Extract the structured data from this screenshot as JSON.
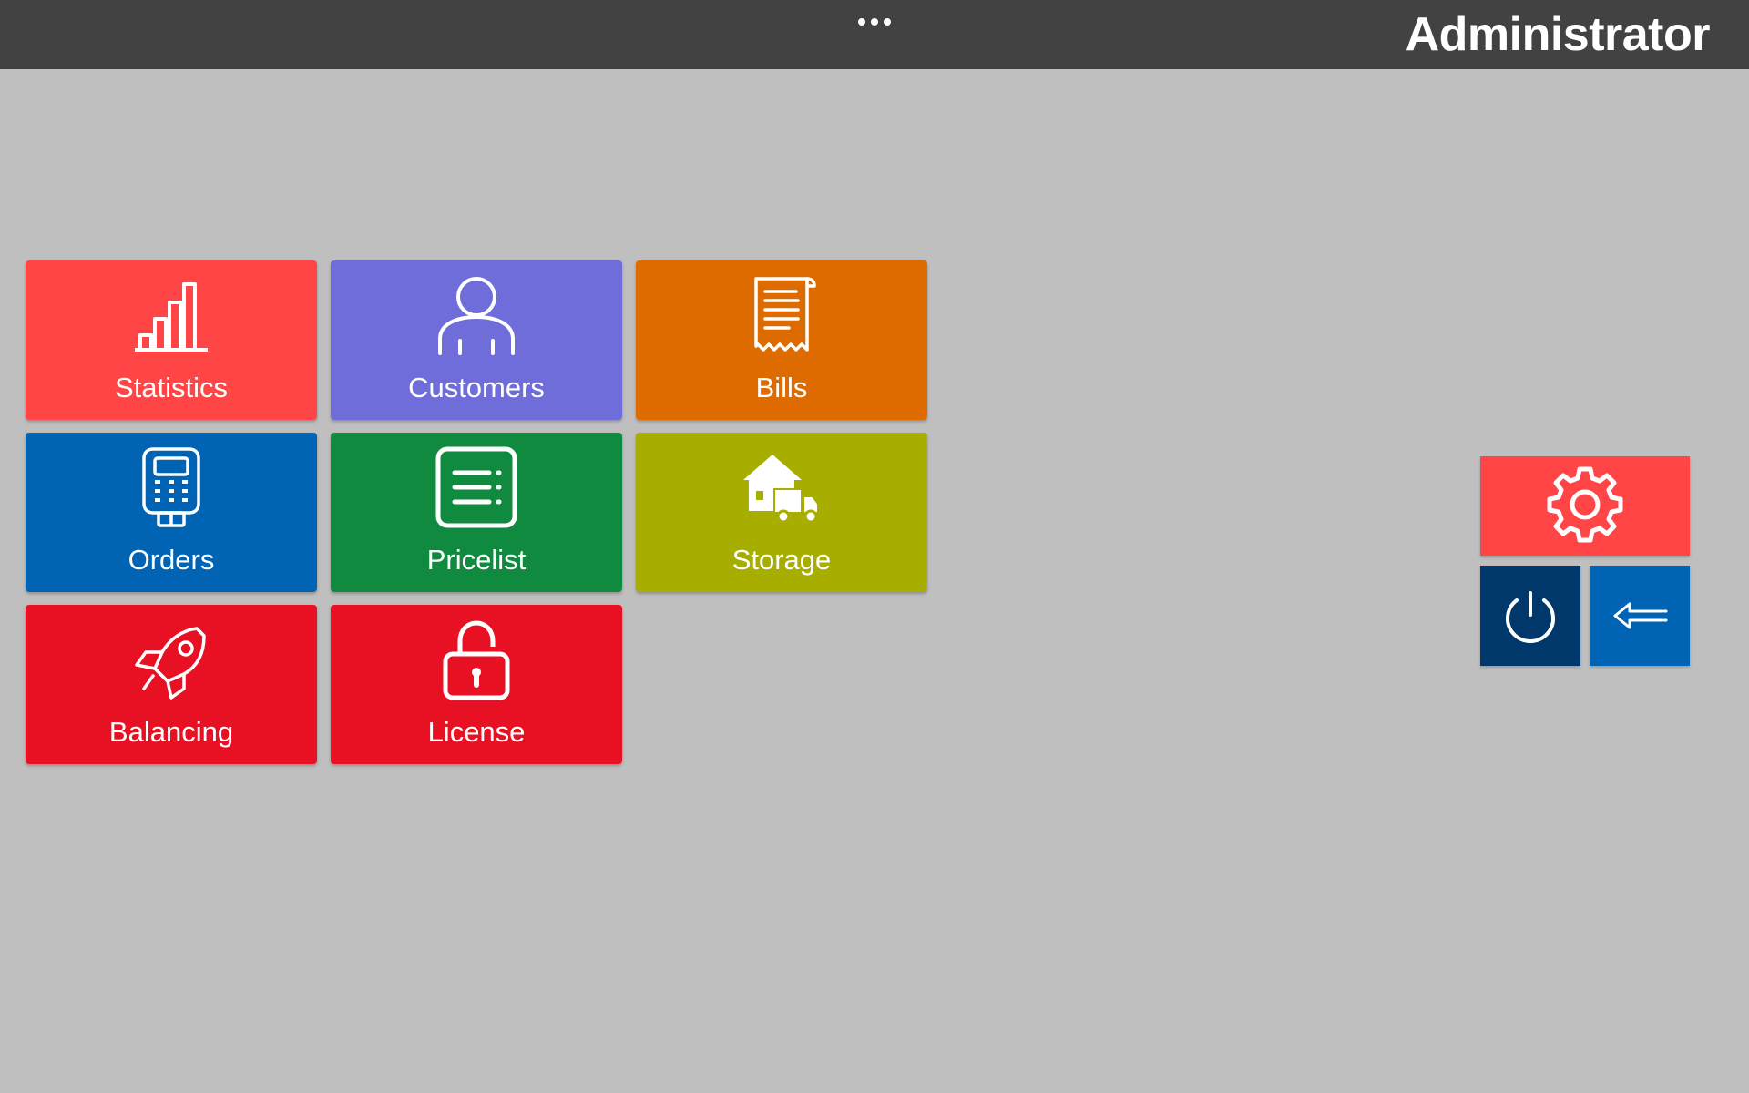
{
  "header": {
    "user_title": "Administrator",
    "menu_icon": "more-horizontal-icon"
  },
  "tiles": [
    {
      "label": "Statistics",
      "icon": "bar-chart-icon",
      "color": "#ff4545"
    },
    {
      "label": "Customers",
      "icon": "user-icon",
      "color": "#6f6dd9"
    },
    {
      "label": "Bills",
      "icon": "receipt-icon",
      "color": "#dd6b00"
    },
    {
      "label": "Orders",
      "icon": "handheld-terminal-icon",
      "color": "#0063b4"
    },
    {
      "label": "Pricelist",
      "icon": "list-icon",
      "color": "#108a3f"
    },
    {
      "label": "Storage",
      "icon": "warehouse-truck-icon",
      "color": "#a8ae00"
    },
    {
      "label": "Balancing",
      "icon": "rocket-icon",
      "color": "#e81123"
    },
    {
      "label": "License",
      "icon": "unlocked-padlock-icon",
      "color": "#e81123"
    }
  ],
  "actions": {
    "settings": {
      "icon": "gear-icon",
      "color": "#ff4545"
    },
    "power": {
      "icon": "power-icon",
      "color": "#00386b"
    },
    "back": {
      "icon": "back-arrow-icon",
      "color": "#0063b4"
    }
  },
  "colors": {
    "background": "#bfbfbf",
    "topbar": "#424242"
  }
}
